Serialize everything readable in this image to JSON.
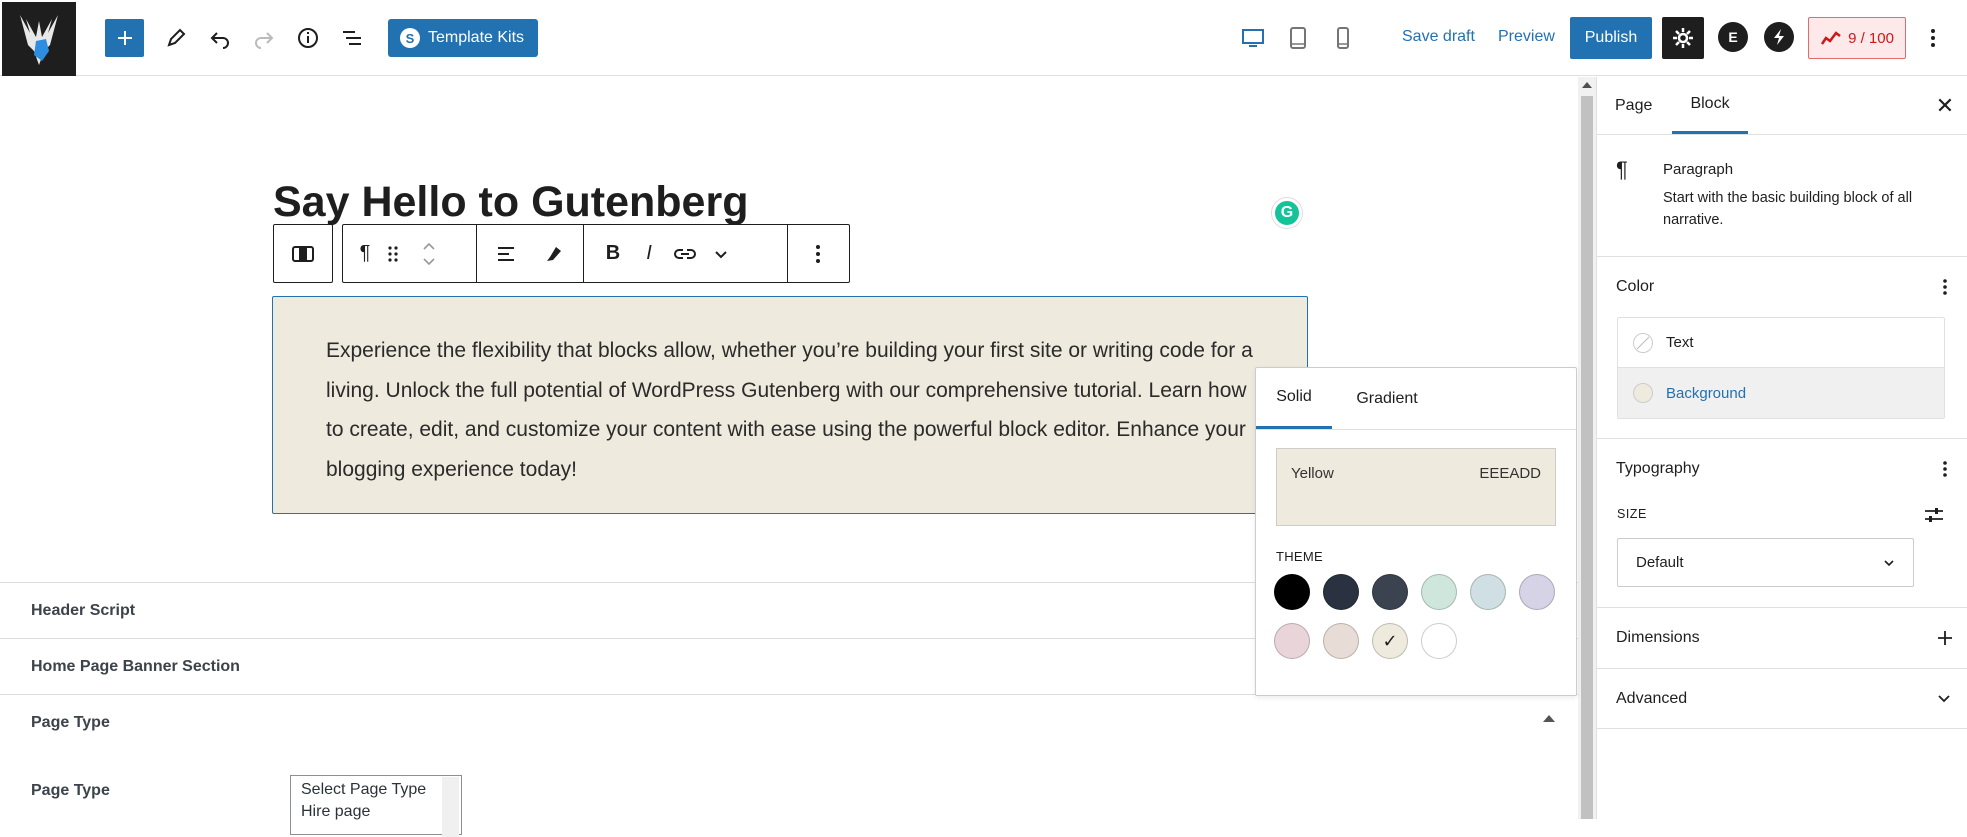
{
  "header": {
    "template_kits_label": "Template Kits",
    "save_draft_label": "Save draft",
    "preview_label": "Preview",
    "publish_label": "Publish",
    "seo_score": "9 / 100"
  },
  "editor": {
    "title": "Say Hello to Gutenberg",
    "paragraph": "Experience the flexibility that blocks allow, whether you’re building your first site or writing code for a living. Unlock the full potential of WordPress Gutenberg with our comprehensive tutorial. Learn how to create, edit, and customize your content with ease using the powerful block editor. Enhance your blogging experience today!",
    "paragraph_background": "#eeeadd"
  },
  "meta_boxes": {
    "header_script": "Header Script",
    "home_banner": "Home Page Banner Section",
    "page_type_section": "Page Type",
    "page_type_label": "Page Type",
    "page_type_options": [
      "Select Page Type",
      "Hire page"
    ]
  },
  "color_popover": {
    "tab_solid": "Solid",
    "tab_gradient": "Gradient",
    "selected_name": "Yellow",
    "selected_hex": "EEEADD",
    "theme_label": "THEME",
    "swatches": [
      "#000000",
      "#2a3140",
      "#3b4350",
      "#cfe6dd",
      "#d0dfe4",
      "#d6d3e6",
      "#e9d5d9",
      "#e8ddd6",
      "#eeeadd",
      "#ffffff"
    ],
    "selected_swatch_mark": "✓"
  },
  "sidebar": {
    "tab_page": "Page",
    "tab_block": "Block",
    "block_name": "Paragraph",
    "block_description": "Start with the basic building block of all narrative.",
    "color_heading": "Color",
    "color_text": "Text",
    "color_background": "Background",
    "typography_heading": "Typography",
    "size_label": "SIZE",
    "size_value": "Default",
    "dimensions_heading": "Dimensions",
    "advanced_heading": "Advanced"
  },
  "colors": {
    "accent": "#2271b1",
    "paragraph_bg": "#eeeadd"
  }
}
